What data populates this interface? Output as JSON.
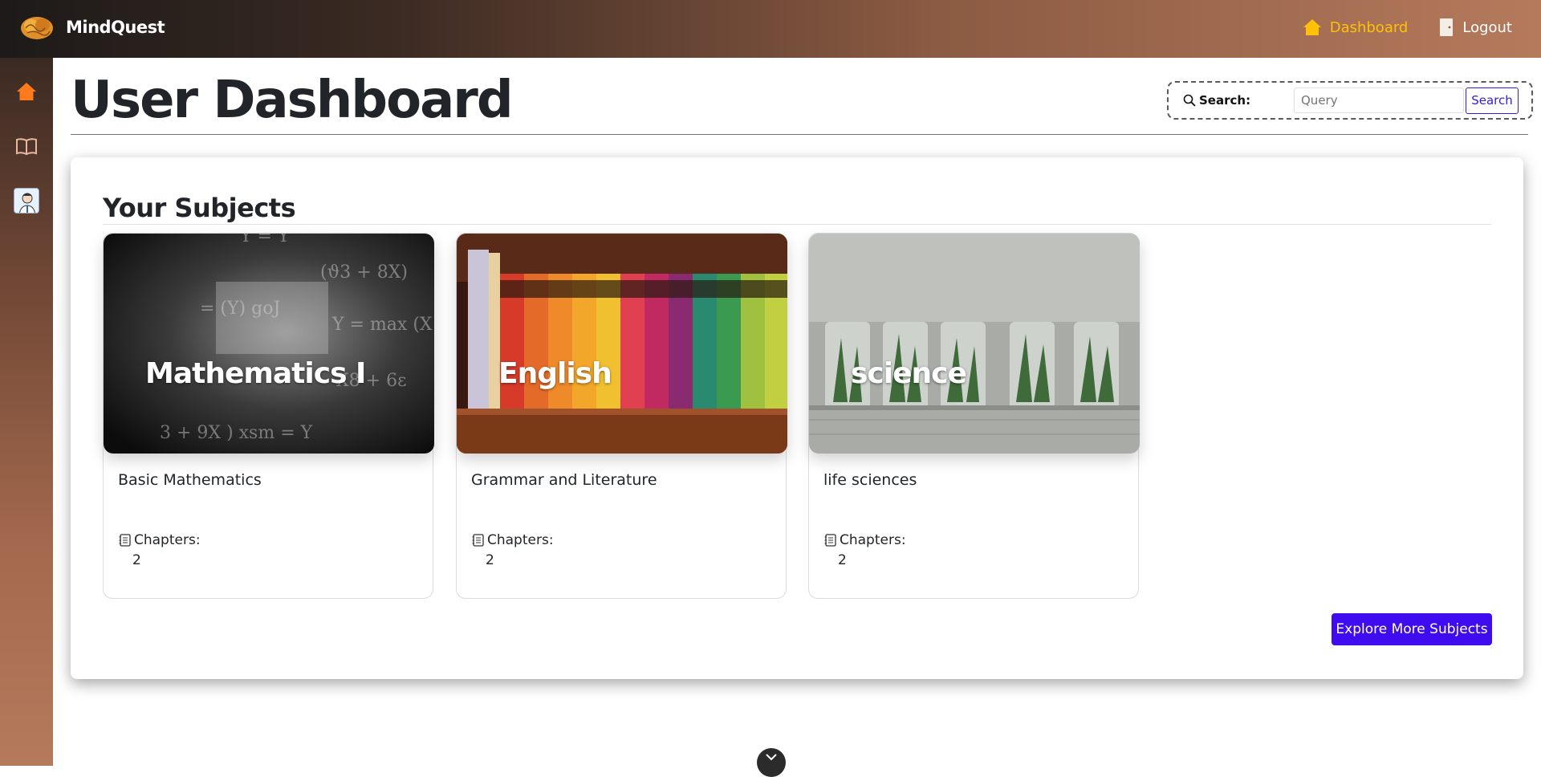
{
  "app": {
    "name": "MindQuest"
  },
  "topnav": {
    "dashboard_label": "Dashboard",
    "logout_label": "Logout",
    "active_color": "#ffc107"
  },
  "sidebar": {
    "items": [
      {
        "icon": "home-icon",
        "active": true
      },
      {
        "icon": "book-icon",
        "active": false
      },
      {
        "icon": "user-avatar",
        "active": false
      }
    ]
  },
  "page": {
    "title": "User Dashboard"
  },
  "search": {
    "label": "Search:",
    "placeholder": "Query",
    "button_label": "Search"
  },
  "subjects": {
    "heading": "Your Subjects",
    "cards": [
      {
        "image_title": "Mathematics I",
        "description": "Basic Mathematics",
        "chapters_label": "Chapters:",
        "chapters": "2"
      },
      {
        "image_title": "English",
        "description": "Grammar and Literature",
        "chapters_label": "Chapters:",
        "chapters": "2"
      },
      {
        "image_title": "science",
        "description": "life sciences",
        "chapters_label": "Chapters:",
        "chapters": "2"
      }
    ],
    "explore_label": "Explore More Subjects"
  },
  "colors": {
    "primary_button": "#3f0cf0",
    "sidebar_active_icon": "#ff7a1a"
  }
}
